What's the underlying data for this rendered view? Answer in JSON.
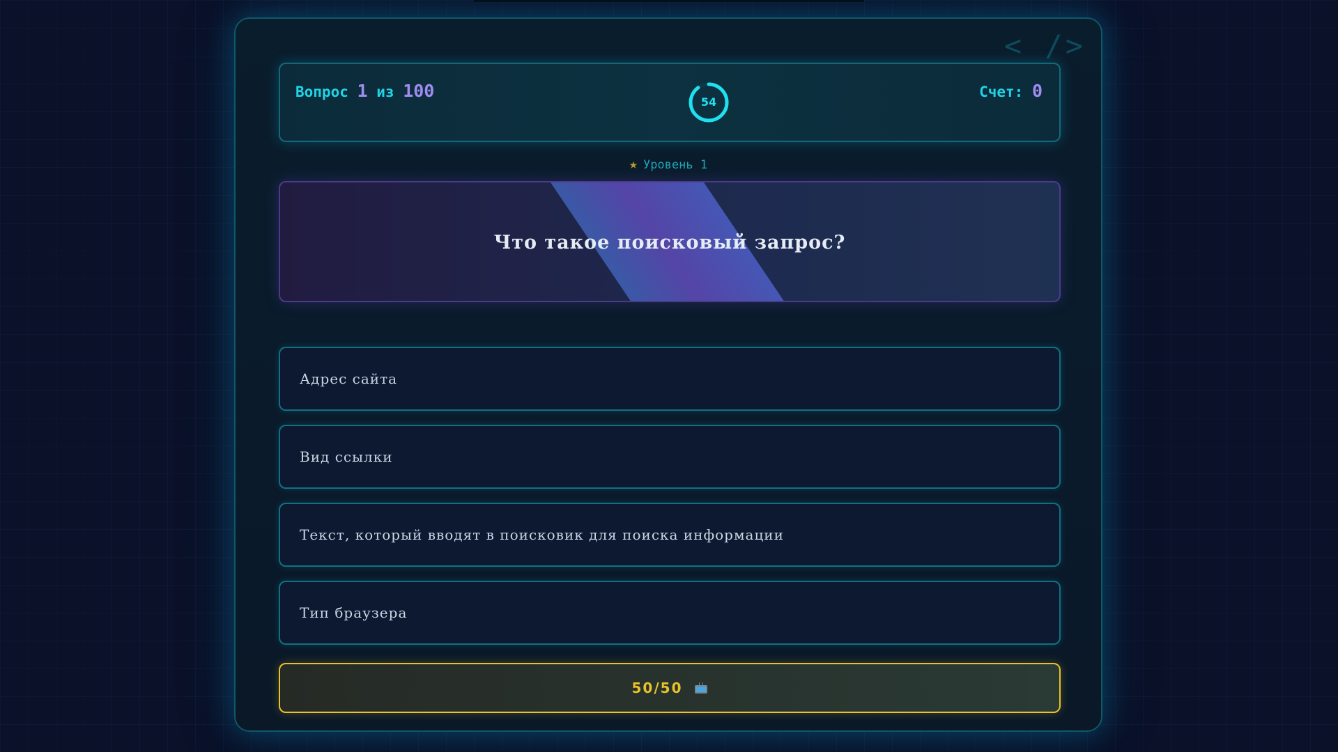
{
  "header": {
    "question_label": "Вопрос",
    "question_current": "1",
    "question_separator": "из",
    "question_total": "100",
    "score_label": "Счет:",
    "score_value": "0"
  },
  "timer": {
    "value": "54",
    "remaining_fraction": 0.9,
    "color": "#20e0f0"
  },
  "level": {
    "icon": "star-icon",
    "label": "Уровень 1"
  },
  "question": {
    "text": "Что такое поисковый запрос?"
  },
  "answers": [
    {
      "label": "Адрес сайта"
    },
    {
      "label": "Вид ссылки"
    },
    {
      "label": "Текст, который вводят в поисковик для поиска информации"
    },
    {
      "label": "Тип браузера"
    }
  ],
  "lifeline": {
    "label": "50/50",
    "icon": "tv-icon",
    "color": "#e7c22a"
  },
  "decor": {
    "code_icon": "code-icon"
  }
}
